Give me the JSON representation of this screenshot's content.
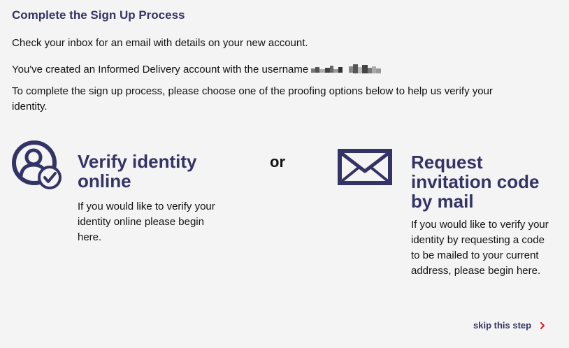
{
  "page": {
    "heading": "Complete the Sign Up Process",
    "inbox_note": "Check your inbox for an email with details on your new account.",
    "created_note": "You've created an Informed Delivery account with the username",
    "instructions": "To complete the sign up process, please choose one of the proofing options below to help us verify your identity."
  },
  "options": {
    "online": {
      "icon": "user-check-icon",
      "title": "Verify identity online",
      "description": "If you would like to verify your identity online please begin here."
    },
    "separator": "or",
    "mail": {
      "icon": "envelope-icon",
      "title": "Request invitation code by mail",
      "description": "If you would like to verify your identity by requesting a code to be mailed to your current address, please begin here."
    }
  },
  "skip": {
    "label": "skip this step",
    "icon": "chevron-right-icon"
  },
  "colors": {
    "brand": "#333366",
    "accent": "#e71921",
    "background": "#f4f4f4"
  }
}
